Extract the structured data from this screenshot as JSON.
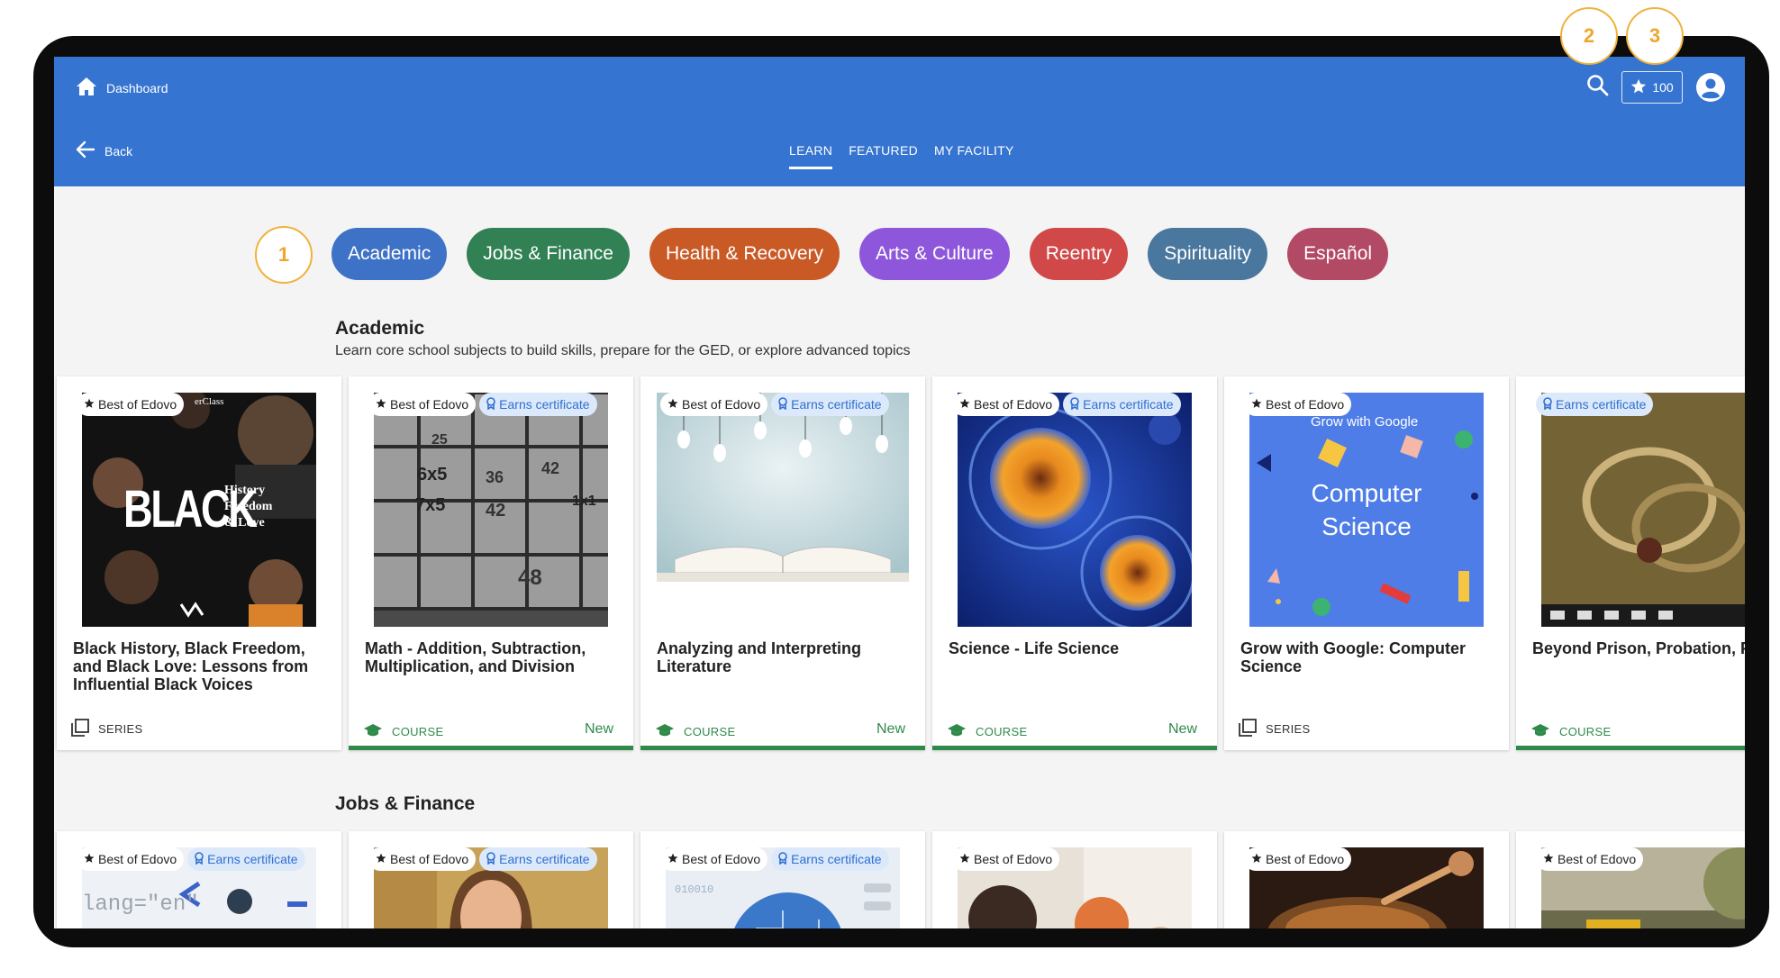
{
  "header": {
    "dashboard_label": "Dashboard",
    "back_label": "Back",
    "tabs": [
      {
        "label": "LEARN"
      },
      {
        "label": "FEATURED"
      },
      {
        "label": "MY FACILITY"
      }
    ],
    "points": "100"
  },
  "callouts": [
    "1",
    "2",
    "3"
  ],
  "categories": [
    {
      "label": "Academic",
      "color": "#3e72c6"
    },
    {
      "label": "Jobs & Finance",
      "color": "#318155"
    },
    {
      "label": "Health & Recovery",
      "color": "#c95a26"
    },
    {
      "label": "Arts & Culture",
      "color": "#8e57db"
    },
    {
      "label": "Reentry",
      "color": "#d04848"
    },
    {
      "label": "Spirituality",
      "color": "#4a779e"
    },
    {
      "label": "Español",
      "color": "#b24a66"
    }
  ],
  "academic": {
    "title": "Academic",
    "description": "Learn core school subjects to build skills, prepare for the GED, or explore advanced topics",
    "cards": [
      {
        "best": "Best of Edovo",
        "cert": "",
        "title": "Black History, Black Freedom, and Black Love: Lessons from Influential Black Voices",
        "type": "SERIES",
        "new": "",
        "thumb_text": "BLACK",
        "thumb_sub": "History Freedom & Love",
        "thumb_corner": "erClass"
      },
      {
        "best": "Best of Edovo",
        "cert": "Earns certificate",
        "title": "Math - Addition, Subtraction, Multiplication, and Division",
        "type": "COURSE",
        "new": "New",
        "tiles": [
          "25",
          "6x5",
          "36",
          "42",
          "7x5",
          "42",
          "1x1",
          "48"
        ]
      },
      {
        "best": "Best of Edovo",
        "cert": "Earns certificate",
        "title": "Analyzing and Interpreting Literature",
        "type": "COURSE",
        "new": "New"
      },
      {
        "best": "Best of Edovo",
        "cert": "Earns certificate",
        "title": "Science - Life Science",
        "type": "COURSE",
        "new": "New"
      },
      {
        "best": "Best of Edovo",
        "cert": "",
        "title": "Grow with Google: Computer Science",
        "type": "SERIES",
        "new": "",
        "thumb_brand": "Grow with Google",
        "thumb_line1": "Computer",
        "thumb_line2": "Science"
      },
      {
        "best": "",
        "cert": "Earns certificate",
        "title": "Beyond Prison, Probation, Parole",
        "type": "COURSE",
        "new": ""
      }
    ]
  },
  "jobs": {
    "title": "Jobs & Finance",
    "cards": [
      {
        "best": "Best of Edovo",
        "cert": "Earns certificate",
        "code_text": "lang=\"en\""
      },
      {
        "best": "Best of Edovo",
        "cert": "Earns certificate"
      },
      {
        "best": "Best of Edovo",
        "cert": "Earns certificate",
        "code_text": "010010"
      },
      {
        "best": "Best of Edovo",
        "cert": ""
      },
      {
        "best": "Best of Edovo",
        "cert": ""
      },
      {
        "best": "Best of Edovo",
        "cert": ""
      }
    ]
  }
}
